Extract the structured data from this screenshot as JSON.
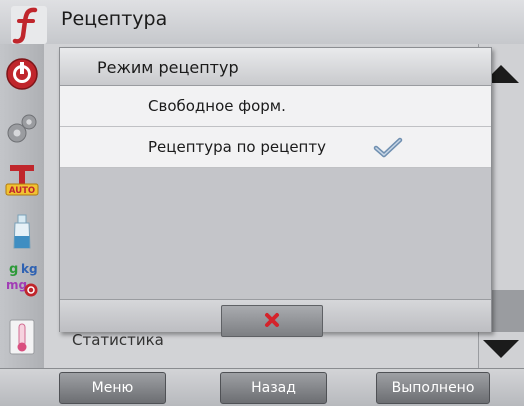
{
  "header": {
    "title": "Рецептура"
  },
  "sidebar": {
    "icons": [
      "function-logo-icon",
      "power-icon",
      "gears-icon",
      "auto-tare-icon",
      "bottle-icon",
      "units-icon",
      "thermometer-icon"
    ],
    "units_text": {
      "top": "g",
      "kg": "kg",
      "mg": "mg"
    },
    "auto_text": "AUTO"
  },
  "background": {
    "partial_item": "Статистика"
  },
  "dialog": {
    "title": "Режим рецептур",
    "options": [
      {
        "label": "Свободное форм.",
        "selected": false
      },
      {
        "label": "Рецептура по рецепту",
        "selected": true
      }
    ],
    "cancel_icon": "close-x-icon"
  },
  "bottom_nav": {
    "menu": "Меню",
    "back": "Назад",
    "done": "Выполнено"
  },
  "colors": {
    "accent_red": "#c0262c",
    "check_blue": "#6f8fb0"
  }
}
